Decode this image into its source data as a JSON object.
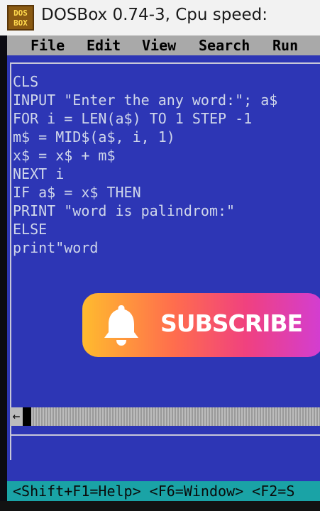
{
  "window": {
    "title": "DOSBox 0.74-3, Cpu speed:",
    "logo_line1": "DOS",
    "logo_line2": "BOX"
  },
  "menu": {
    "items": [
      "File",
      "Edit",
      "View",
      "Search",
      "Run"
    ]
  },
  "editor": {
    "lines": [
      "CLS",
      "INPUT \"Enter the any word:\"; a$",
      "FOR i = LEN(a$) TO 1 STEP -1",
      "m$ = MID$(a$, i, 1)",
      "x$ = x$ + m$",
      "NEXT i",
      "IF a$ = x$ THEN",
      "PRINT \"word is palindrom:\"",
      "ELSE",
      "print\"word"
    ]
  },
  "scrollbar": {
    "left_arrow": "←"
  },
  "status": {
    "text": "<Shift+F1=Help> <F6=Window> <F2=S"
  },
  "overlay": {
    "subscribe_label": "SUBSCRIBE",
    "icon": "bell-icon"
  },
  "colors": {
    "screen_bg": "#2d36b5",
    "code_text": "#cfd6ea",
    "menu_bg": "#a9a9a9",
    "status_bg": "#1aa3a6"
  }
}
